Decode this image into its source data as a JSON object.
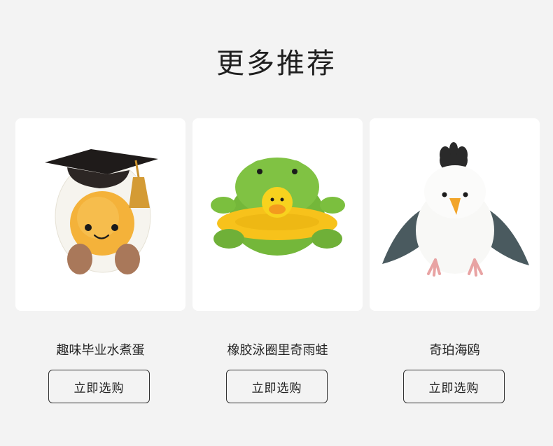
{
  "section": {
    "title": "更多推荐"
  },
  "products": [
    {
      "name": "趣味毕业水煮蛋",
      "button_label": "立即选购",
      "icon": "graduation-egg-plush"
    },
    {
      "name": "橡胶泳圈里奇雨蛙",
      "button_label": "立即选购",
      "icon": "frog-swim-ring-plush"
    },
    {
      "name": "奇珀海鸥",
      "button_label": "立即选购",
      "icon": "seagull-plush"
    }
  ]
}
